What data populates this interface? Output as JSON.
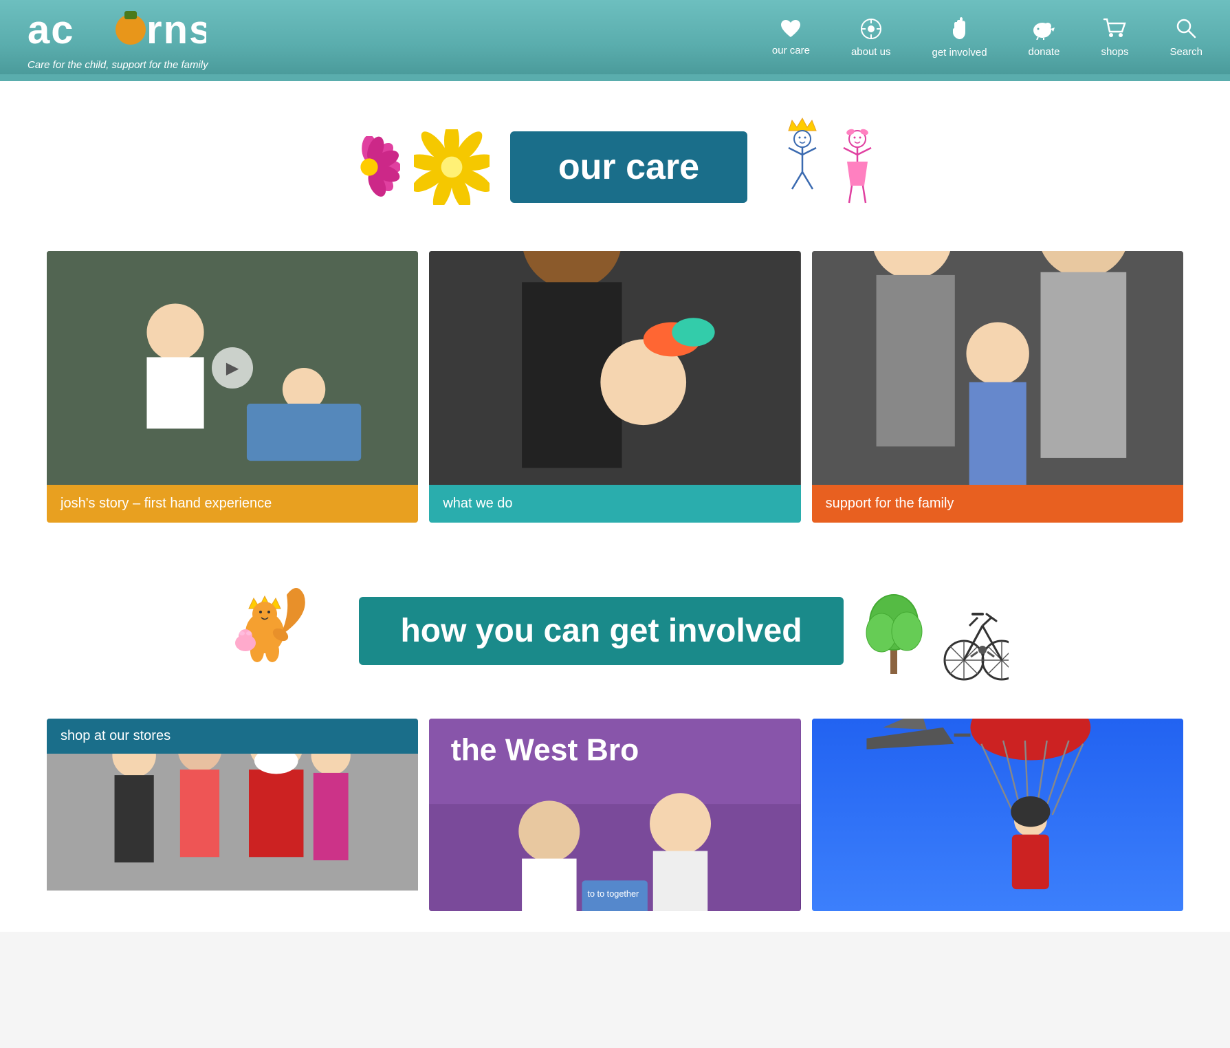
{
  "header": {
    "logo": "acorns",
    "tagline": "Care for the child, support for the family",
    "nav": [
      {
        "id": "our-care",
        "label": "our care",
        "icon": "♡"
      },
      {
        "id": "about-us",
        "label": "about us",
        "icon": "◉"
      },
      {
        "id": "get-involved",
        "label": "get involved",
        "icon": "✋"
      },
      {
        "id": "donate",
        "label": "donate",
        "icon": "🐷"
      },
      {
        "id": "shops",
        "label": "shops",
        "icon": "🛒"
      },
      {
        "id": "search",
        "label": "Search",
        "icon": "🔍"
      }
    ]
  },
  "hero": {
    "title": "our care"
  },
  "photo_cards": [
    {
      "id": "josh-story",
      "caption": "josh's story – first hand experience",
      "caption_class": "caption-1",
      "has_play": true
    },
    {
      "id": "what-we-do",
      "caption": "what we do",
      "caption_class": "caption-2",
      "has_play": false
    },
    {
      "id": "support-family",
      "caption": "support for the family",
      "caption_class": "caption-3",
      "has_play": false
    }
  ],
  "get_involved": {
    "title": "how you can get involved"
  },
  "bottom_cards": [
    {
      "id": "shop-stores",
      "caption": "shop at our stores",
      "has_caption_overlay": true
    },
    {
      "id": "west-brom",
      "caption": "",
      "has_caption_overlay": false
    },
    {
      "id": "skydive",
      "caption": "",
      "has_caption_overlay": false
    }
  ]
}
